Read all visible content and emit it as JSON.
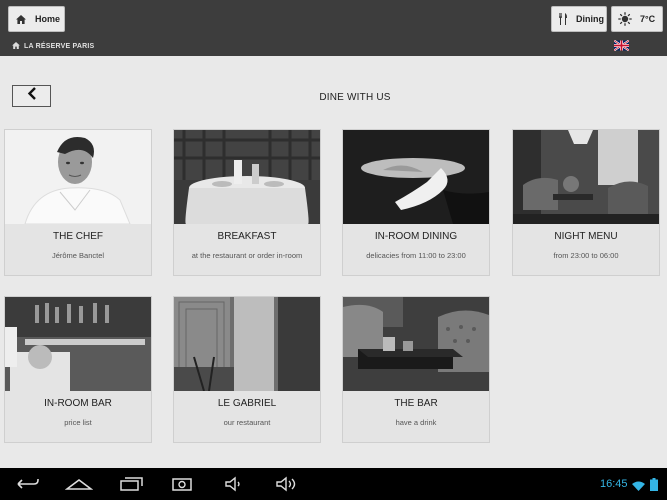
{
  "topbar": {
    "home_label": "Home",
    "home_icon": "home-icon",
    "dining_label": "Dining",
    "dining_icon": "cutlery-icon",
    "weather_label": "7°C",
    "weather_icon": "sun-icon"
  },
  "breadcrumb": {
    "label": "LA RÉSERVE PARIS",
    "icon": "home-icon"
  },
  "language_flag": "uk-flag-icon",
  "page": {
    "title": "DINE WITH US",
    "back_icon": "chevron-left-icon"
  },
  "cards": [
    {
      "title": "THE CHEF",
      "subtitle": "Jérôme Banctel"
    },
    {
      "title": "BREAKFAST",
      "subtitle": "at the restaurant or order in-room"
    },
    {
      "title": "IN-ROOM DINING",
      "subtitle": "delicacies from 11:00 to 23:00"
    },
    {
      "title": "NIGHT MENU",
      "subtitle": "from 23:00 to 06:00"
    },
    {
      "title": "IN-ROOM BAR",
      "subtitle": "price list"
    },
    {
      "title": "LE GABRIEL",
      "subtitle": "our restaurant"
    },
    {
      "title": "THE BAR",
      "subtitle": "have a drink"
    }
  ],
  "system_bar": {
    "time": "16:45",
    "accent": "#34b5e5",
    "nav_icons": [
      "back-icon",
      "home-icon",
      "recents-icon",
      "screenshot-icon",
      "volume-down-icon",
      "volume-up-icon"
    ]
  }
}
